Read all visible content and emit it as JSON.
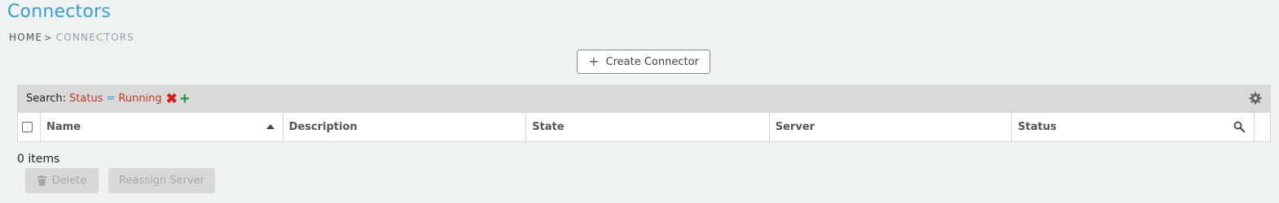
{
  "page": {
    "title": "Connectors",
    "breadcrumb": {
      "home": "HOME",
      "separator": ">",
      "current": "CONNECTORS"
    }
  },
  "toolbar": {
    "create_icon": "+",
    "create_label": "Create Connector"
  },
  "search": {
    "label": "Search:",
    "filter": {
      "field": "Status",
      "operator": "=",
      "value": "Running"
    },
    "remove_icon": "✖",
    "add_icon": "+"
  },
  "table": {
    "columns": [
      "Name",
      "Description",
      "State",
      "Server",
      "Status"
    ],
    "sort": {
      "column": "Name",
      "direction": "ascending"
    },
    "rows": []
  },
  "footer": {
    "items_count": "0 items",
    "delete_label": "Delete",
    "reassign_label": "Reassign Server"
  },
  "colors": {
    "accent": "#3b9cd6",
    "filter_text": "#c0392b",
    "remove": "#d62020",
    "add": "#1e9b36",
    "background": "#eff2f2"
  }
}
